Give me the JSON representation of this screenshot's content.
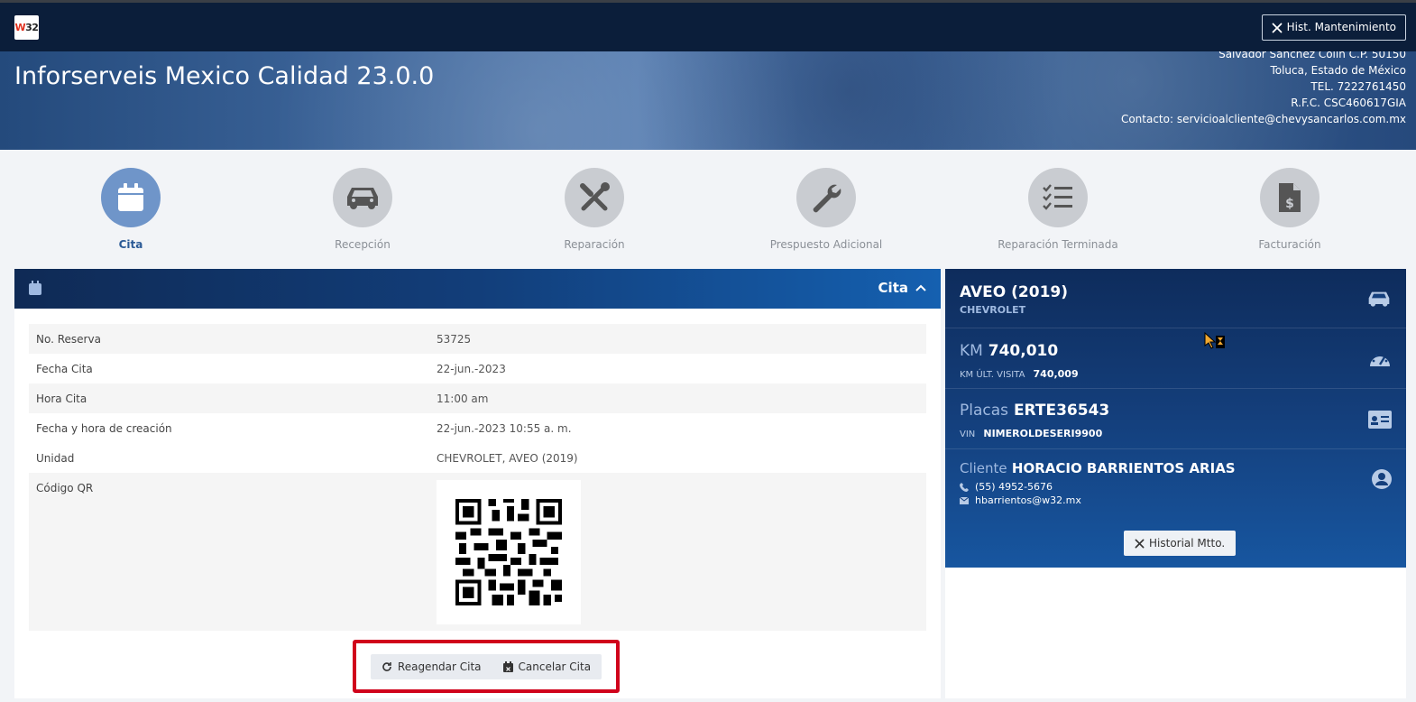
{
  "topbar": {
    "logo_prefix": "W",
    "logo_suffix": "32",
    "hist_button": "Hist. Mantenimiento"
  },
  "banner": {
    "title": "Inforserveis Mexico Calidad 23.0.0",
    "company_lines": [
      "Salvador Sánchez Colín C.P. 50150",
      "Toluca, Estado de México",
      "TEL. 7222761450",
      "R.F.C. CSC460617GIA",
      "Contacto: servicioalcliente@chevysancarlos.com.mx"
    ]
  },
  "steps": [
    {
      "label": "Cita",
      "icon": "calendar-icon",
      "active": true
    },
    {
      "label": "Recepción",
      "icon": "car-icon",
      "active": false
    },
    {
      "label": "Reparación",
      "icon": "tools-icon",
      "active": false
    },
    {
      "label": "Prespuesto Adicional",
      "icon": "wrench-icon",
      "active": false
    },
    {
      "label": "Reparación Terminada",
      "icon": "checklist-icon",
      "active": false
    },
    {
      "label": "Facturación",
      "icon": "invoice-icon",
      "active": false
    }
  ],
  "cita": {
    "title": "Cita",
    "rows": [
      {
        "key": "No. Reserva",
        "value": "53725"
      },
      {
        "key": "Fecha Cita",
        "value": "22-jun.-2023"
      },
      {
        "key": "Hora Cita",
        "value": "11:00 am"
      },
      {
        "key": "Fecha y hora de creación",
        "value": "22-jun.-2023 10:55 a. m."
      },
      {
        "key": "Unidad",
        "value": "CHEVROLET, AVEO (2019)"
      }
    ],
    "qr_label": "Código QR",
    "reagendar": "Reagendar Cita",
    "cancelar": "Cancelar Cita"
  },
  "vehicle": {
    "model": "AVEO (2019)",
    "brand": "CHEVROLET",
    "km_label": "KM",
    "km_value": "740,010",
    "km_last_label": "KM ÚLT. VISITA",
    "km_last_value": "740,009",
    "plates_label": "Placas",
    "plates_value": "ERTE36543",
    "vin_label": "VIN",
    "vin_value": "NIMEROLDESERI9900",
    "client_label": "Cliente",
    "client_name": "HORACIO BARRIENTOS ARIAS",
    "phone": "(55) 4952-5676",
    "email": "hbarrientos@w32.mx",
    "historial_button": "Historial Mtto."
  },
  "colors": {
    "navbar": "#0b1e3a",
    "active_step": "#6f95c9",
    "inactive_step": "#c9ccd1",
    "highlight_border": "#d0021b"
  }
}
